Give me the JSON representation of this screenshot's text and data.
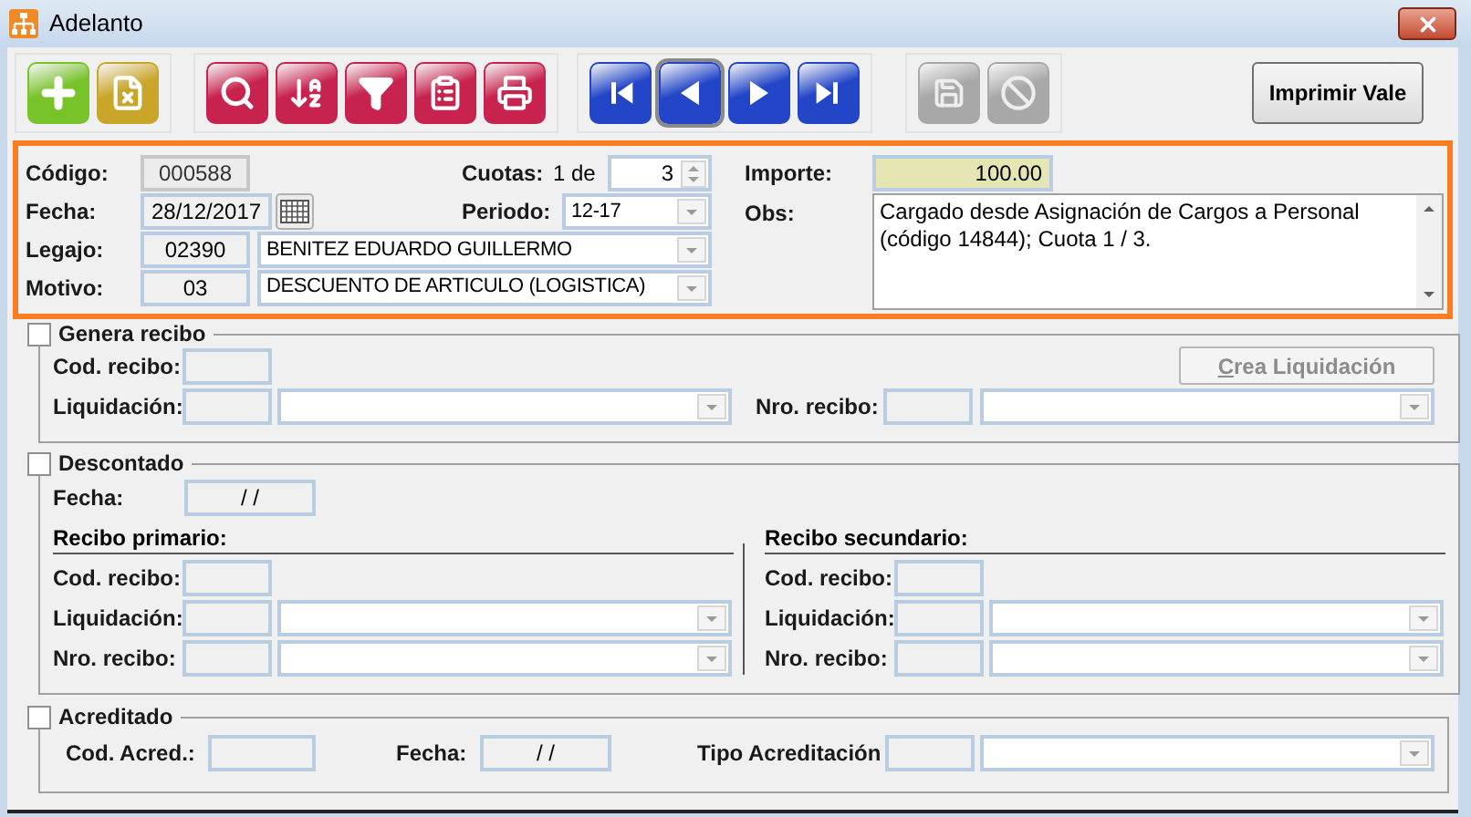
{
  "window": {
    "title": "Adelanto"
  },
  "toolbar": {
    "groups": [
      {
        "buttons": [
          {
            "kind": "add",
            "color": "#78c22a",
            "focused": false
          },
          {
            "kind": "document",
            "color": "#c9a52a",
            "focused": false
          }
        ]
      },
      {
        "buttons": [
          {
            "kind": "search",
            "color": "#c8234f",
            "focused": false
          },
          {
            "kind": "sort",
            "color": "#c8234f",
            "focused": false
          },
          {
            "kind": "filter",
            "color": "#c8234f",
            "focused": false
          },
          {
            "kind": "report",
            "color": "#c8234f",
            "focused": false
          },
          {
            "kind": "print",
            "color": "#c8234f",
            "focused": false
          }
        ]
      },
      {
        "buttons": [
          {
            "kind": "first",
            "color": "#2346c8",
            "focused": false
          },
          {
            "kind": "prev",
            "color": "#2346c8",
            "focused": true
          },
          {
            "kind": "next",
            "color": "#2346c8",
            "focused": false
          },
          {
            "kind": "last",
            "color": "#2346c8",
            "focused": false
          }
        ]
      },
      {
        "buttons": [
          {
            "kind": "save",
            "color": "#a8a8a8",
            "focused": false
          },
          {
            "kind": "cancel",
            "color": "#a8a8a8",
            "focused": false
          }
        ]
      }
    ],
    "print_button": "Imprimir Vale"
  },
  "header": {
    "codigo": {
      "label": "Código:",
      "value": "000588"
    },
    "cuotas": {
      "label": "Cuotas:",
      "prefix": "1 de",
      "value": "3"
    },
    "fecha": {
      "label": "Fecha:",
      "value": "28/12/2017"
    },
    "periodo": {
      "label": "Periodo:",
      "value": "12-17"
    },
    "legajo": {
      "label": "Legajo:",
      "code": "02390",
      "name": "BENITEZ EDUARDO GUILLERMO"
    },
    "motivo": {
      "label": "Motivo:",
      "code": "03",
      "name": "DESCUENTO DE ARTICULO (LOGISTICA)"
    },
    "importe": {
      "label": "Importe:",
      "value": "100.00"
    },
    "obs": {
      "label": "Obs:",
      "value": "Cargado desde Asignación de Cargos a Personal (código 14844); Cuota 1 / 3."
    }
  },
  "genera_recibo": {
    "label": "Genera recibo",
    "checked": false,
    "cod_recibo_label": "Cod. recibo:",
    "liquidacion_label": "Liquidación:",
    "nro_recibo_label": "Nro. recibo:",
    "button": {
      "label": "Crea Liquidación",
      "disabled": true
    }
  },
  "descontado": {
    "label": "Descontado",
    "checked": false,
    "fecha_label": "Fecha:",
    "fecha_value": "/ /",
    "primary": {
      "title": "Recibo primario:",
      "cod_recibo_label": "Cod. recibo:",
      "liquidacion_label": "Liquidación:",
      "nro_recibo_label": "Nro. recibo:"
    },
    "secondary": {
      "title": "Recibo secundario:",
      "cod_recibo_label": "Cod. recibo:",
      "liquidacion_label": "Liquidación:",
      "nro_recibo_label": "Nro. recibo:"
    }
  },
  "acreditado": {
    "label": "Acreditado",
    "checked": false,
    "cod_label": "Cod. Acred.:",
    "fecha_label": "Fecha:",
    "fecha_value": "/ /",
    "tipo_label": "Tipo Acreditación"
  }
}
